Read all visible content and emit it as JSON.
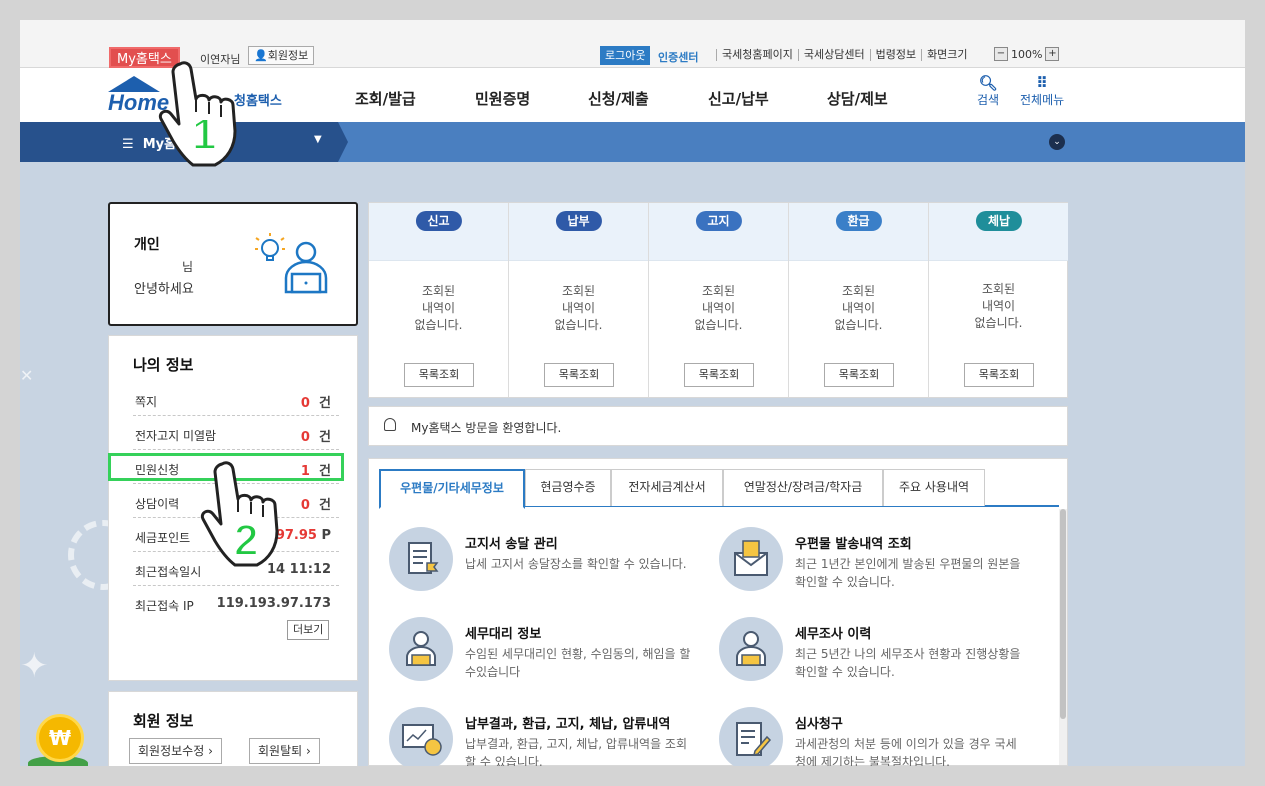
{
  "topbar": {
    "my_tab": "My홈택스",
    "user_name": "이연자님",
    "member_info": "회원정보",
    "logout": "로그아웃",
    "cert_center": "인증센터",
    "links": [
      "국세청홈페이지",
      "국세상담센터",
      "법령정보",
      "화면크기"
    ],
    "zoom_minus": "−",
    "zoom_value": "100%",
    "zoom_plus": "+"
  },
  "nav": {
    "logo_text": "Home",
    "logo_sub": "청홈택스",
    "menus": [
      "조회/발급",
      "민원증명",
      "신청/제출",
      "신고/납부",
      "상담/제보"
    ],
    "search_label": "검색",
    "allmenu_label": "전체메뉴"
  },
  "bluebar": {
    "menu_label": "My홈"
  },
  "profile": {
    "title": "개인",
    "nim": "님",
    "greeting": "안녕하세요"
  },
  "my_info": {
    "title": "나의 정보",
    "rows": [
      {
        "label": "쪽지",
        "value": "0",
        "unit": "건"
      },
      {
        "label": "전자고지 미열람",
        "value": "0",
        "unit": "건"
      },
      {
        "label": "민원신청",
        "value": "1",
        "unit": "건"
      },
      {
        "label": "상담이력",
        "value": "0",
        "unit": "건"
      },
      {
        "label": "세금포인트",
        "value": "97.95",
        "unit": "P"
      },
      {
        "label": "최근접속일시",
        "value": "14 11:12",
        "unit": ""
      },
      {
        "label": "최근접속 IP",
        "value": "119.193.97.173",
        "unit": ""
      }
    ],
    "more": "더보기"
  },
  "member": {
    "title": "회원 정보",
    "edit": "회원정보수정",
    "withdraw": "회원탈퇴"
  },
  "status": {
    "columns": [
      {
        "badge": "신고",
        "color": "#2f5aa8",
        "msg": [
          "조회된",
          "내역이",
          "없습니다."
        ],
        "button": "목록조회"
      },
      {
        "badge": "납부",
        "color": "#2f5aa8",
        "msg": [
          "조회된",
          "내역이",
          "없습니다."
        ],
        "button": "목록조회"
      },
      {
        "badge": "고지",
        "color": "#3a72c0",
        "msg": [
          "조회된",
          "내역이",
          "없습니다."
        ],
        "button": "목록조회"
      },
      {
        "badge": "환급",
        "color": "#3a7fc8",
        "msg": [
          "조회된",
          "내역이",
          "없습니다."
        ],
        "button": "목록조회"
      },
      {
        "badge": "체납",
        "color": "#1f8e9a",
        "msg": [
          "조회된",
          "내역이",
          "없습니다."
        ],
        "button": "목록조회"
      }
    ]
  },
  "notice": "My홈택스 방문을 환영합니다.",
  "tabs": [
    "우편물/기타세무정보",
    "현금영수증",
    "전자세금계산서",
    "연말정산/장려금/학자금",
    "주요 사용내역"
  ],
  "services": [
    {
      "title": "고지서 송달 관리",
      "desc": "납세 고지서 송달장소를 확인할 수 있습니다."
    },
    {
      "title": "우편물 발송내역 조회",
      "desc": "최근 1년간 본인에게 발송된 우편물의 원본을 확인할 수 있습니다."
    },
    {
      "title": "세무대리 정보",
      "desc": "수임된 세무대리인 현황, 수임동의, 해임을 할수있습니다"
    },
    {
      "title": "세무조사 이력",
      "desc": "최근 5년간 나의 세무조사 현황과 진행상황을 확인할 수 있습니다."
    },
    {
      "title": "납부결과, 환급, 고지, 체납, 압류내역",
      "desc": "납부결과, 환급, 고지, 체납, 압류내역을 조회할 수 있습니다."
    },
    {
      "title": "심사청구",
      "desc": "과세관청의 처분 등에 이의가 있을 경우 국세청에 제기하는 불복절차입니다."
    }
  ],
  "annotations": {
    "step1": "1",
    "step2": "2"
  },
  "colors": {
    "brand_blue": "#1d5fae",
    "highlight_green": "#35d15a",
    "my_tab_red": "#e24f4f"
  }
}
